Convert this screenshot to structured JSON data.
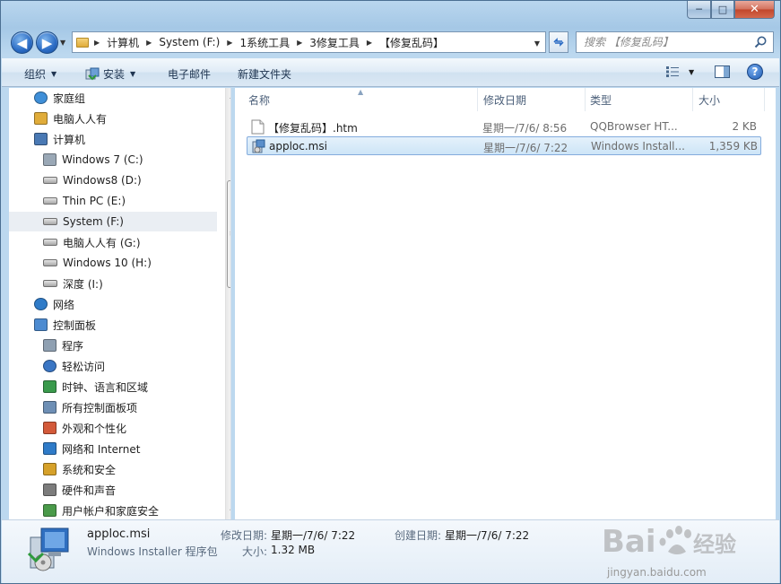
{
  "window": {
    "caption_buttons": {
      "minimize": "─",
      "maximize": "□",
      "close": "✕"
    }
  },
  "nav": {
    "back_glyph": "◀",
    "forward_glyph": "▶",
    "breadcrumbs": [
      "计算机",
      "System (F:)",
      "1系统工具",
      "3修复工具",
      "【修复乱码】"
    ],
    "search_placeholder": "搜索 【修复乱码】"
  },
  "toolbar": {
    "organize": "组织",
    "install": "安装",
    "email": "电子邮件",
    "new_folder": "新建文件夹",
    "help": "?"
  },
  "navpane": {
    "items": [
      {
        "label": "家庭组",
        "icon": "homegroup-icon"
      },
      {
        "label": "电脑人人有",
        "icon": "user-folder-icon"
      },
      {
        "label": "计算机",
        "icon": "computer-icon"
      },
      {
        "label": "Windows 7  (C:)",
        "icon": "windows-drive-icon"
      },
      {
        "label": "Windows8 (D:)",
        "icon": "drive-icon"
      },
      {
        "label": "Thin PC (E:)",
        "icon": "drive-icon"
      },
      {
        "label": "System (F:)",
        "icon": "drive-icon"
      },
      {
        "label": "电脑人人有 (G:)",
        "icon": "drive-icon"
      },
      {
        "label": "Windows 10 (H:)",
        "icon": "drive-icon"
      },
      {
        "label": "深度 (I:)",
        "icon": "drive-icon"
      },
      {
        "label": "网络",
        "icon": "network-icon"
      },
      {
        "label": "控制面板",
        "icon": "control-panel-icon"
      },
      {
        "label": "程序",
        "icon": "programs-icon"
      },
      {
        "label": "轻松访问",
        "icon": "ease-of-access-icon"
      },
      {
        "label": "时钟、语言和区域",
        "icon": "clock-language-icon"
      },
      {
        "label": "所有控制面板项",
        "icon": "all-control-panel-icon"
      },
      {
        "label": "外观和个性化",
        "icon": "appearance-icon"
      },
      {
        "label": "网络和 Internet",
        "icon": "network-internet-icon"
      },
      {
        "label": "系统和安全",
        "icon": "system-security-icon"
      },
      {
        "label": "硬件和声音",
        "icon": "hardware-sound-icon"
      },
      {
        "label": "用户帐户和家庭安全",
        "icon": "user-accounts-icon"
      }
    ],
    "selected": "System (F:)"
  },
  "filelist": {
    "columns": {
      "name": "名称",
      "date": "修改日期",
      "type": "类型",
      "size": "大小"
    },
    "rows": [
      {
        "name": "【修复乱码】.htm",
        "date": "星期一/7/6/ 8:56",
        "type": "QQBrowser HT...",
        "size": "2 KB",
        "icon": "html-file-icon"
      },
      {
        "name": "apploc.msi",
        "date": "星期一/7/6/ 7:22",
        "type": "Windows Install...",
        "size": "1,359 KB",
        "icon": "msi-file-icon"
      }
    ]
  },
  "details": {
    "name": "apploc.msi",
    "type": "Windows Installer 程序包",
    "modified_label": "修改日期:",
    "modified_value": "星期一/7/6/ 7:22",
    "created_label": "创建日期:",
    "created_value": "星期一/7/6/ 7:22",
    "size_label": "大小:",
    "size_value": "1.32 MB"
  },
  "watermark": {
    "brand": "Bai du 经验",
    "url": "jingyan.baidu.com"
  }
}
